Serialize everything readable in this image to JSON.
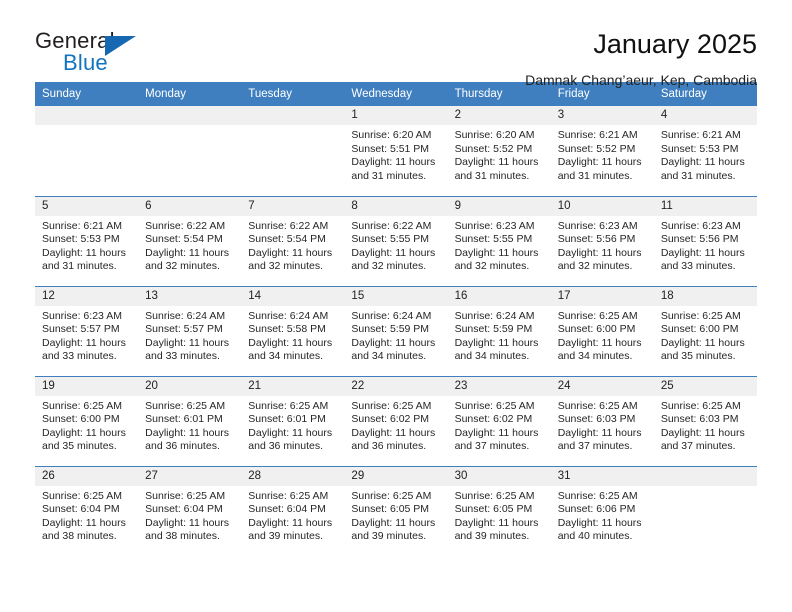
{
  "brand": {
    "name_part1": "General",
    "name_part2": "Blue",
    "logo_icon": "blue-triangle-icon",
    "color_primary": "#1273bf",
    "color_dark": "#231f20"
  },
  "header": {
    "title": "January 2025",
    "subtitle": "Damnak Chang’aeur, Kep, Cambodia",
    "header_bg": "#3f7fbf",
    "header_text": "#ffffff"
  },
  "weekday_headers": [
    "Sunday",
    "Monday",
    "Tuesday",
    "Wednesday",
    "Thursday",
    "Friday",
    "Saturday"
  ],
  "labels": {
    "sunrise_prefix": "Sunrise:",
    "sunset_prefix": "Sunset:",
    "daylight_prefix": "Daylight:"
  },
  "weeks": [
    [
      {
        "day": "",
        "sunrise": "",
        "sunset": "",
        "daylight_line1": "",
        "daylight_line2": "",
        "empty": true
      },
      {
        "day": "",
        "sunrise": "",
        "sunset": "",
        "daylight_line1": "",
        "daylight_line2": "",
        "empty": true
      },
      {
        "day": "",
        "sunrise": "",
        "sunset": "",
        "daylight_line1": "",
        "daylight_line2": "",
        "empty": true
      },
      {
        "day": "1",
        "sunrise": "Sunrise: 6:20 AM",
        "sunset": "Sunset: 5:51 PM",
        "daylight_line1": "Daylight: 11 hours",
        "daylight_line2": "and 31 minutes."
      },
      {
        "day": "2",
        "sunrise": "Sunrise: 6:20 AM",
        "sunset": "Sunset: 5:52 PM",
        "daylight_line1": "Daylight: 11 hours",
        "daylight_line2": "and 31 minutes."
      },
      {
        "day": "3",
        "sunrise": "Sunrise: 6:21 AM",
        "sunset": "Sunset: 5:52 PM",
        "daylight_line1": "Daylight: 11 hours",
        "daylight_line2": "and 31 minutes."
      },
      {
        "day": "4",
        "sunrise": "Sunrise: 6:21 AM",
        "sunset": "Sunset: 5:53 PM",
        "daylight_line1": "Daylight: 11 hours",
        "daylight_line2": "and 31 minutes."
      }
    ],
    [
      {
        "day": "5",
        "sunrise": "Sunrise: 6:21 AM",
        "sunset": "Sunset: 5:53 PM",
        "daylight_line1": "Daylight: 11 hours",
        "daylight_line2": "and 31 minutes."
      },
      {
        "day": "6",
        "sunrise": "Sunrise: 6:22 AM",
        "sunset": "Sunset: 5:54 PM",
        "daylight_line1": "Daylight: 11 hours",
        "daylight_line2": "and 32 minutes."
      },
      {
        "day": "7",
        "sunrise": "Sunrise: 6:22 AM",
        "sunset": "Sunset: 5:54 PM",
        "daylight_line1": "Daylight: 11 hours",
        "daylight_line2": "and 32 minutes."
      },
      {
        "day": "8",
        "sunrise": "Sunrise: 6:22 AM",
        "sunset": "Sunset: 5:55 PM",
        "daylight_line1": "Daylight: 11 hours",
        "daylight_line2": "and 32 minutes."
      },
      {
        "day": "9",
        "sunrise": "Sunrise: 6:23 AM",
        "sunset": "Sunset: 5:55 PM",
        "daylight_line1": "Daylight: 11 hours",
        "daylight_line2": "and 32 minutes."
      },
      {
        "day": "10",
        "sunrise": "Sunrise: 6:23 AM",
        "sunset": "Sunset: 5:56 PM",
        "daylight_line1": "Daylight: 11 hours",
        "daylight_line2": "and 32 minutes."
      },
      {
        "day": "11",
        "sunrise": "Sunrise: 6:23 AM",
        "sunset": "Sunset: 5:56 PM",
        "daylight_line1": "Daylight: 11 hours",
        "daylight_line2": "and 33 minutes."
      }
    ],
    [
      {
        "day": "12",
        "sunrise": "Sunrise: 6:23 AM",
        "sunset": "Sunset: 5:57 PM",
        "daylight_line1": "Daylight: 11 hours",
        "daylight_line2": "and 33 minutes."
      },
      {
        "day": "13",
        "sunrise": "Sunrise: 6:24 AM",
        "sunset": "Sunset: 5:57 PM",
        "daylight_line1": "Daylight: 11 hours",
        "daylight_line2": "and 33 minutes."
      },
      {
        "day": "14",
        "sunrise": "Sunrise: 6:24 AM",
        "sunset": "Sunset: 5:58 PM",
        "daylight_line1": "Daylight: 11 hours",
        "daylight_line2": "and 34 minutes."
      },
      {
        "day": "15",
        "sunrise": "Sunrise: 6:24 AM",
        "sunset": "Sunset: 5:59 PM",
        "daylight_line1": "Daylight: 11 hours",
        "daylight_line2": "and 34 minutes."
      },
      {
        "day": "16",
        "sunrise": "Sunrise: 6:24 AM",
        "sunset": "Sunset: 5:59 PM",
        "daylight_line1": "Daylight: 11 hours",
        "daylight_line2": "and 34 minutes."
      },
      {
        "day": "17",
        "sunrise": "Sunrise: 6:25 AM",
        "sunset": "Sunset: 6:00 PM",
        "daylight_line1": "Daylight: 11 hours",
        "daylight_line2": "and 34 minutes."
      },
      {
        "day": "18",
        "sunrise": "Sunrise: 6:25 AM",
        "sunset": "Sunset: 6:00 PM",
        "daylight_line1": "Daylight: 11 hours",
        "daylight_line2": "and 35 minutes."
      }
    ],
    [
      {
        "day": "19",
        "sunrise": "Sunrise: 6:25 AM",
        "sunset": "Sunset: 6:00 PM",
        "daylight_line1": "Daylight: 11 hours",
        "daylight_line2": "and 35 minutes."
      },
      {
        "day": "20",
        "sunrise": "Sunrise: 6:25 AM",
        "sunset": "Sunset: 6:01 PM",
        "daylight_line1": "Daylight: 11 hours",
        "daylight_line2": "and 36 minutes."
      },
      {
        "day": "21",
        "sunrise": "Sunrise: 6:25 AM",
        "sunset": "Sunset: 6:01 PM",
        "daylight_line1": "Daylight: 11 hours",
        "daylight_line2": "and 36 minutes."
      },
      {
        "day": "22",
        "sunrise": "Sunrise: 6:25 AM",
        "sunset": "Sunset: 6:02 PM",
        "daylight_line1": "Daylight: 11 hours",
        "daylight_line2": "and 36 minutes."
      },
      {
        "day": "23",
        "sunrise": "Sunrise: 6:25 AM",
        "sunset": "Sunset: 6:02 PM",
        "daylight_line1": "Daylight: 11 hours",
        "daylight_line2": "and 37 minutes."
      },
      {
        "day": "24",
        "sunrise": "Sunrise: 6:25 AM",
        "sunset": "Sunset: 6:03 PM",
        "daylight_line1": "Daylight: 11 hours",
        "daylight_line2": "and 37 minutes."
      },
      {
        "day": "25",
        "sunrise": "Sunrise: 6:25 AM",
        "sunset": "Sunset: 6:03 PM",
        "daylight_line1": "Daylight: 11 hours",
        "daylight_line2": "and 37 minutes."
      }
    ],
    [
      {
        "day": "26",
        "sunrise": "Sunrise: 6:25 AM",
        "sunset": "Sunset: 6:04 PM",
        "daylight_line1": "Daylight: 11 hours",
        "daylight_line2": "and 38 minutes."
      },
      {
        "day": "27",
        "sunrise": "Sunrise: 6:25 AM",
        "sunset": "Sunset: 6:04 PM",
        "daylight_line1": "Daylight: 11 hours",
        "daylight_line2": "and 38 minutes."
      },
      {
        "day": "28",
        "sunrise": "Sunrise: 6:25 AM",
        "sunset": "Sunset: 6:04 PM",
        "daylight_line1": "Daylight: 11 hours",
        "daylight_line2": "and 39 minutes."
      },
      {
        "day": "29",
        "sunrise": "Sunrise: 6:25 AM",
        "sunset": "Sunset: 6:05 PM",
        "daylight_line1": "Daylight: 11 hours",
        "daylight_line2": "and 39 minutes."
      },
      {
        "day": "30",
        "sunrise": "Sunrise: 6:25 AM",
        "sunset": "Sunset: 6:05 PM",
        "daylight_line1": "Daylight: 11 hours",
        "daylight_line2": "and 39 minutes."
      },
      {
        "day": "31",
        "sunrise": "Sunrise: 6:25 AM",
        "sunset": "Sunset: 6:06 PM",
        "daylight_line1": "Daylight: 11 hours",
        "daylight_line2": "and 40 minutes."
      },
      {
        "day": "",
        "sunrise": "",
        "sunset": "",
        "daylight_line1": "",
        "daylight_line2": "",
        "empty": true
      }
    ]
  ]
}
